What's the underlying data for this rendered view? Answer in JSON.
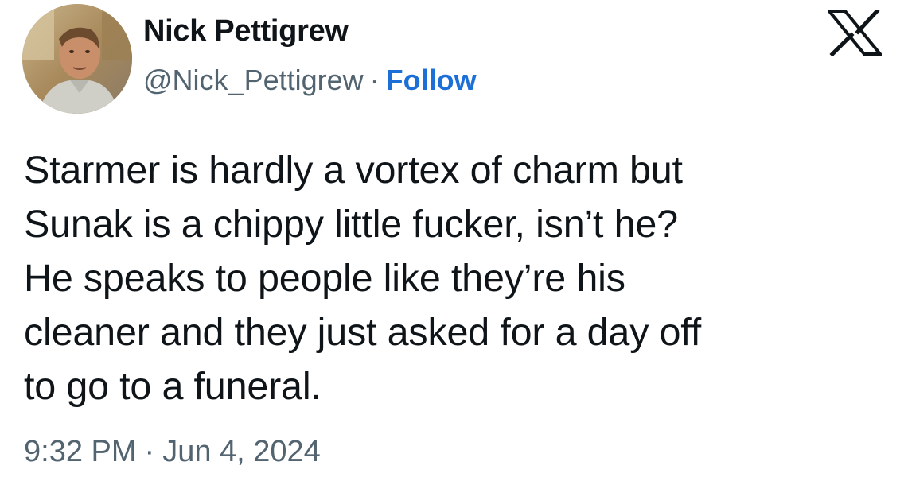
{
  "author": {
    "display_name": "Nick Pettigrew",
    "handle": "@Nick_Pettigrew",
    "separator": "·",
    "follow_label": "Follow"
  },
  "brand": {
    "logo_icon": "x-logo-icon"
  },
  "tweet": {
    "text_lines": [
      "Starmer is hardly a vortex of charm but",
      "Sunak is a chippy little fucker, isn’t he?",
      "He speaks to people like they’re his",
      "cleaner and they just asked for a day off",
      "to go to a funeral."
    ]
  },
  "meta": {
    "time": "9:32 PM",
    "separator": "·",
    "date": "Jun 4, 2024"
  },
  "colors": {
    "text": "#0f1419",
    "secondary": "#536471",
    "follow": "#1d6fd8"
  }
}
